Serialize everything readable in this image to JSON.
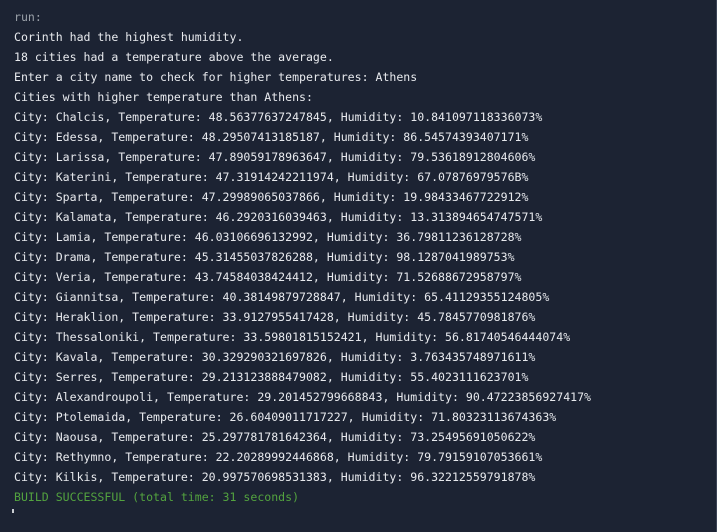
{
  "console": {
    "run_label": "run:",
    "summary": [
      "Corinth had the highest humidity.",
      "18 cities had a temperature above the average."
    ],
    "prompt": "Enter a city name to check for higher temperatures: Athens",
    "results_header": "Cities with higher temperature than Athens:",
    "rows": [
      "City: Chalcis, Temperature: 48.56377637247845, Humidity: 10.841097118336073%",
      "City: Edessa, Temperature: 48.29507413185187, Humidity: 86.54574393407171%",
      "City: Larissa, Temperature: 47.89059178963647, Humidity: 79.53618912804606%",
      "City: Katerini, Temperature: 47.31914242211974, Humidity: 67.07876979576B%",
      "City: Sparta, Temperature: 47.29989065037866, Humidity: 19.98433467722912%",
      "City: Kalamata, Temperature: 46.2920316039463, Humidity: 13.313894654747571%",
      "City: Lamia, Temperature: 46.03106696132992, Humidity: 36.79811236128728%",
      "City: Drama, Temperature: 45.31455037826288, Humidity: 98.1287041989753%",
      "City: Veria, Temperature: 43.74584038424412, Humidity: 71.52688672958797%",
      "City: Giannitsa, Temperature: 40.38149879728847, Humidity: 65.41129355124805%",
      "City: Heraklion, Temperature: 33.9127955417428, Humidity: 45.7845770981876%",
      "City: Thessaloniki, Temperature: 33.59801815152421, Humidity: 56.81740546444074%",
      "City: Kavala, Temperature: 30.329290321697826, Humidity: 3.763435748971611%",
      "City: Serres, Temperature: 29.213123888479082, Humidity: 55.4023111623701%",
      "City: Alexandroupoli, Temperature: 29.201452799668843, Humidity: 90.47223856927417%",
      "City: Ptolemaida, Temperature: 26.60409011717227, Humidity: 71.80323113674363%",
      "City: Naousa, Temperature: 25.297781781642364, Humidity: 73.25495691050622%",
      "City: Rethymno, Temperature: 22.20289992446868, Humidity: 79.79159107053661%",
      "City: Kilkis, Temperature: 20.997570698531383, Humidity: 96.32212559791878%"
    ],
    "build_status": "BUILD SUCCESSFUL (total time: 31 seconds)"
  }
}
